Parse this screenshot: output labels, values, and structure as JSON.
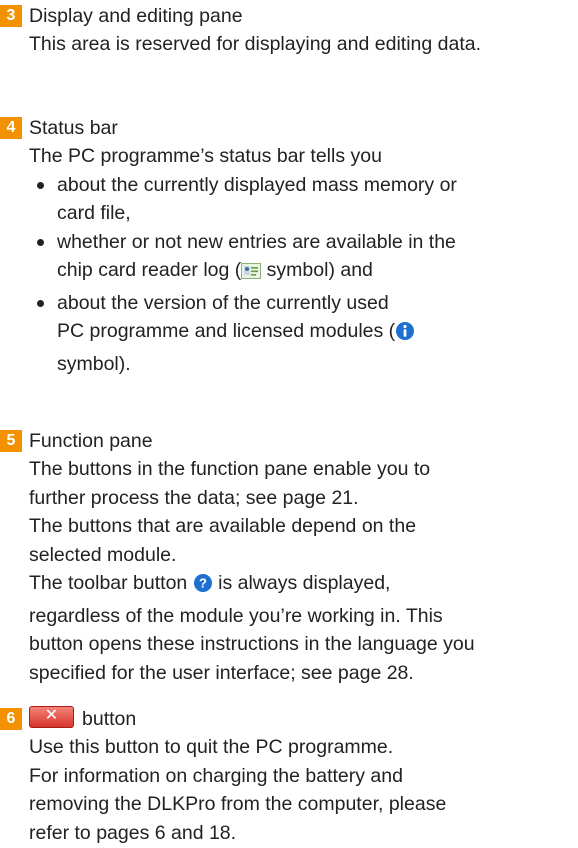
{
  "sections": [
    {
      "number": "3",
      "title": "Display and editing pane",
      "lines": [
        "This area is reserved for displaying and editing data."
      ]
    },
    {
      "number": "4",
      "title": "Status bar",
      "intro": "The PC programme’s status bar tells you",
      "bullets": [
        [
          "about the currently displayed mass memory or",
          "card file,"
        ],
        [
          "whether or not new entries are available in the",
          "chip card reader log (",
          " symbol) and"
        ],
        [
          "about the version of the currently used",
          "PC programme and licensed modules (",
          "symbol)."
        ]
      ]
    },
    {
      "number": "5",
      "title": "Function pane",
      "lines": [
        "The buttons in the function pane enable you to",
        "further process the data; see page 21.",
        "The buttons that are available depend on the",
        "selected module."
      ],
      "toolbar_pre": "The toolbar button ",
      "toolbar_post": " is always displayed,",
      "lines2": [
        "regardless of the module you’re working in. This",
        "button opens these instructions in the language you",
        "specified for the user interface; see page 28."
      ]
    },
    {
      "number": "6",
      "button_glyph": "✕",
      "title": "button",
      "lines": [
        "Use this button to quit the PC programme.",
        "For information on charging the battery and",
        "removing the DLKPro from the computer, please",
        "refer to pages 6 and 18."
      ]
    }
  ],
  "colors": {
    "badge": "#f39200",
    "info_icon": "#1d6fd1",
    "close_button": "#d7352a"
  },
  "icons": [
    "card-reader-log-icon",
    "info-icon",
    "help-icon",
    "close-icon"
  ]
}
